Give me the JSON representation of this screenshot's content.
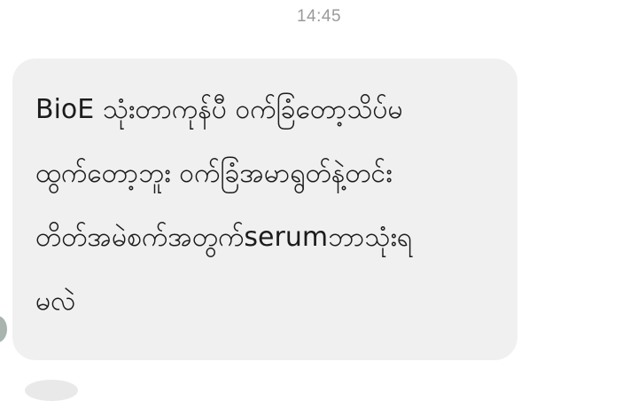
{
  "header": {
    "timestamp": "14:45"
  },
  "message": {
    "lines": [
      "BioE သုံးတာကုန်ပီ ဝက်ခြံတော့သိပ်မ",
      "ထွက်တော့ဘူး ဝက်ခြံအမာရွတ်နဲ့တင်း",
      "တိတ်အမဲစက်အတွက်serumဘာသုံးရ",
      "မလဲ"
    ]
  }
}
